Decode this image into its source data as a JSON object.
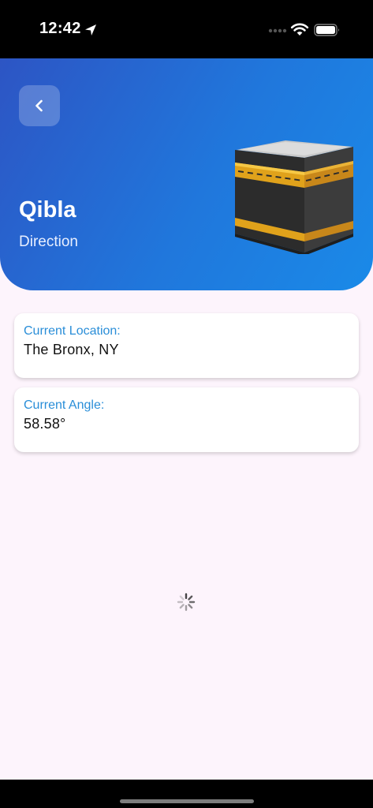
{
  "status_bar": {
    "time": "12:42",
    "icons": [
      "location-arrow-icon",
      "signal-dots-icon",
      "wifi-icon",
      "battery-icon"
    ]
  },
  "header": {
    "title": "Qibla",
    "subtitle": "Direction",
    "back_icon": "chevron-left-icon",
    "illustration": "kaaba-icon",
    "gradient": [
      "#2d55c4",
      "#1a8ae8"
    ]
  },
  "location_card": {
    "label": "Current Location:",
    "value": "The Bronx, NY"
  },
  "angle_card": {
    "label": "Current Angle:",
    "value": "58.58°"
  },
  "loading": {
    "icon": "activity-spinner-icon"
  },
  "colors": {
    "accent": "#2a8ed8",
    "background": "#fdf4fc"
  }
}
